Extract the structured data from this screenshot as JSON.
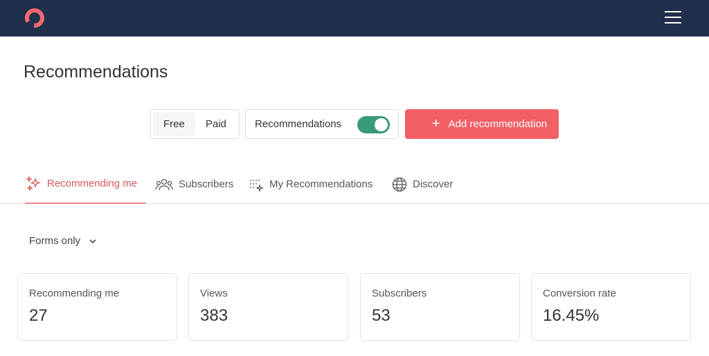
{
  "header": {
    "logo": "brand-logo",
    "menu_icon": "hamburger-icon"
  },
  "page_title": "Recommendations",
  "segment": {
    "options": [
      "Free",
      "Paid"
    ],
    "selected": "Free"
  },
  "toggle": {
    "label": "Recommendations",
    "on": true
  },
  "add_button": {
    "label": "Add recommendation"
  },
  "tabs": [
    {
      "label": "Recommending me",
      "icon": "sparkles-icon",
      "active": true
    },
    {
      "label": "Subscribers",
      "icon": "users-icon"
    },
    {
      "label": "My Recommendations",
      "icon": "list-sparkle-icon"
    },
    {
      "label": "Discover",
      "icon": "globe-icon"
    }
  ],
  "filter": {
    "label": "Forms only"
  },
  "stats": [
    {
      "label": "Recommending me",
      "value": "27"
    },
    {
      "label": "Views",
      "value": "383"
    },
    {
      "label": "Subscribers",
      "value": "53"
    },
    {
      "label": "Conversion rate",
      "value": "16.45%"
    }
  ]
}
